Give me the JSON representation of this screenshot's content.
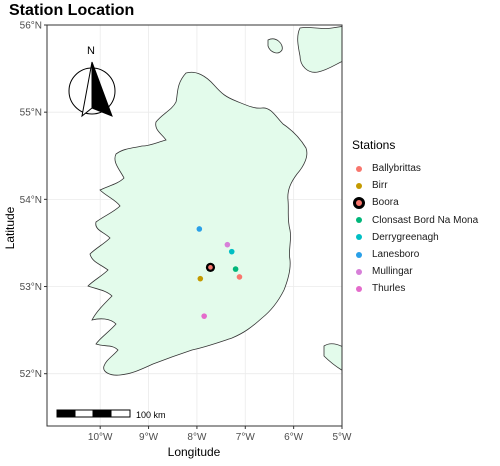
{
  "chart_data": {
    "type": "scatter",
    "title": "Station Location",
    "xlabel": "Longitude",
    "ylabel": "Latitude",
    "xlim": [
      -11.1,
      -5.0
    ],
    "ylim": [
      51.4,
      56.0
    ],
    "x_ticks": [
      {
        "value": -10,
        "label": "10°W"
      },
      {
        "value": -9,
        "label": "9°W"
      },
      {
        "value": -8,
        "label": "8°W"
      },
      {
        "value": -7,
        "label": "7°W"
      },
      {
        "value": -6,
        "label": "6°W"
      },
      {
        "value": -5,
        "label": "5°W"
      }
    ],
    "y_ticks": [
      {
        "value": 52,
        "label": "52°N"
      },
      {
        "value": 53,
        "label": "53°N"
      },
      {
        "value": 54,
        "label": "54°N"
      },
      {
        "value": 55,
        "label": "55°N"
      },
      {
        "value": 56,
        "label": "56°N"
      }
    ],
    "grid": true,
    "legend_title": "Stations",
    "legend_position": "right",
    "series": [
      {
        "name": "Ballybrittas",
        "color": "#F8766D",
        "x": -7.12,
        "y": 53.11
      },
      {
        "name": "Birr",
        "color": "#C49A00",
        "x": -7.93,
        "y": 53.09
      },
      {
        "name": "Boora",
        "color": "#F8766D",
        "x": -7.72,
        "y": 53.22,
        "highlight": true
      },
      {
        "name": "Clonsast Bord Na Mona",
        "color": "#00B67A",
        "x": -7.2,
        "y": 53.2
      },
      {
        "name": "Derrygreenagh",
        "color": "#00BFC4",
        "x": -7.28,
        "y": 53.4
      },
      {
        "name": "Lanesboro",
        "color": "#2AA0E8",
        "x": -7.95,
        "y": 53.66
      },
      {
        "name": "Mullingar",
        "color": "#D77FD8",
        "x": -7.37,
        "y": 53.48
      },
      {
        "name": "Thurles",
        "color": "#E46BCB",
        "x": -7.85,
        "y": 52.66
      }
    ]
  },
  "map": {
    "land_color": "#E3FBEB",
    "coast_color": "#333333",
    "north_arrow_label": "N",
    "scale_bar_label": "100 km"
  }
}
